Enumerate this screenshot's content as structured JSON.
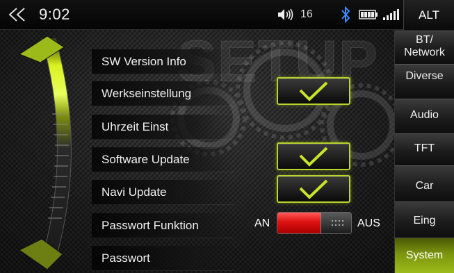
{
  "statusbar": {
    "time": "9:02",
    "volume_level": "16",
    "alt_label": "ALT",
    "icons": [
      "back-icon",
      "volume-icon",
      "bluetooth-icon",
      "battery-icon",
      "signal-icon"
    ]
  },
  "watermark": "SETUP",
  "menu": [
    {
      "label": "SW Version Info"
    },
    {
      "label": "Werkseinstellung"
    },
    {
      "label": "Uhrzeit Einst"
    },
    {
      "label": "Software Update"
    },
    {
      "label": "Navi Update"
    },
    {
      "label": "Passwort Funktion"
    },
    {
      "label": "Passwort"
    }
  ],
  "password_toggle": {
    "on_label": "AN",
    "off_label": "AUS",
    "position": "off"
  },
  "tabs": [
    {
      "label": "BT/\nNetwork",
      "active": false
    },
    {
      "label": "Diverse",
      "active": false
    },
    {
      "label": "Audio",
      "active": false
    },
    {
      "label": "TFT",
      "active": false
    },
    {
      "label": "Car",
      "active": false
    },
    {
      "label": "Eing",
      "active": false
    },
    {
      "label": "System",
      "active": true
    }
  ],
  "colors": {
    "accent": "#b9d42a",
    "active_tab": "#8aa814",
    "toggle_red": "#d11111"
  }
}
